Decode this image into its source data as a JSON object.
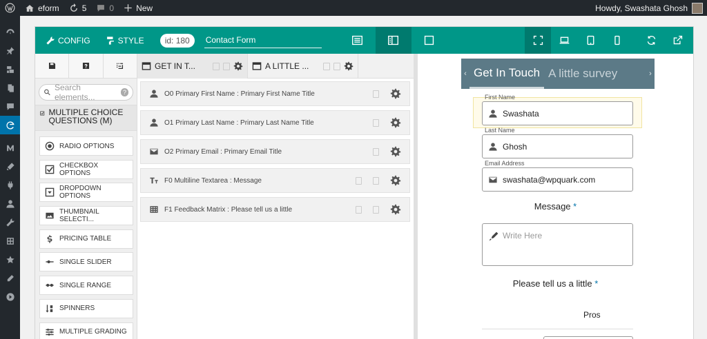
{
  "adminbar": {
    "site_name": "eform",
    "updates_count": "5",
    "comments_count": "0",
    "new_label": "New",
    "greeting": "Howdy, Swashata Ghosh"
  },
  "toolbar": {
    "config_label": "CONFIG",
    "style_label": "STYLE",
    "form_id": "id: 180",
    "form_title": "Contact Form"
  },
  "sidebar": {
    "search_placeholder": "Search elements...",
    "category_label": "MULTIPLE CHOICE QUESTIONS (M)",
    "elements": [
      {
        "label": "RADIO OPTIONS",
        "icon": "radio-icon"
      },
      {
        "label": "CHECKBOX OPTIONS",
        "icon": "checkbox-icon"
      },
      {
        "label": "DROPDOWN OPTIONS",
        "icon": "dropdown-icon"
      },
      {
        "label": "THUMBNAIL SELECTI...",
        "icon": "image-icon"
      },
      {
        "label": "PRICING TABLE",
        "icon": "dollar-icon"
      },
      {
        "label": "SINGLE SLIDER",
        "icon": "slider-icon"
      },
      {
        "label": "SINGLE RANGE",
        "icon": "range-icon"
      },
      {
        "label": "SPINNERS",
        "icon": "spinner-icon"
      },
      {
        "label": "MULTIPLE GRADING",
        "icon": "grading-icon"
      }
    ]
  },
  "form_tabs": [
    {
      "label": "GET IN T..."
    },
    {
      "label": "A LITTLE ..."
    }
  ],
  "fields": [
    {
      "label": "O0 Primary First Name : Primary First Name Title",
      "icon": "user-icon"
    },
    {
      "label": "O1 Primary Last Name : Primary Last Name Title",
      "icon": "user-icon"
    },
    {
      "label": "O2 Primary Email : Primary Email Title",
      "icon": "envelope-icon"
    },
    {
      "label": "F0 Multiline Textarea : Message",
      "icon": "text-icon"
    },
    {
      "label": "F1 Feedback Matrix : Please tell us a little",
      "icon": "table-icon"
    }
  ],
  "preview": {
    "tab_active": "Get In Touch",
    "tab_inactive": "A little survey",
    "first_name_label": "First Name",
    "first_name_value": "Swashata",
    "last_name_label": "Last Name",
    "last_name_value": "Ghosh",
    "email_label": "Email Address",
    "email_value": "swashata@wpquark.com",
    "message_title": "Message",
    "message_placeholder": "Write Here",
    "feedback_title": "Please tell us a little",
    "required_mark": "*",
    "pros_label": "Pros"
  },
  "colors": {
    "toolbar": "#009788",
    "toolbar_active": "#007a6e",
    "preview_tabs": "#5c7a87",
    "admin_bar": "#23282d"
  }
}
